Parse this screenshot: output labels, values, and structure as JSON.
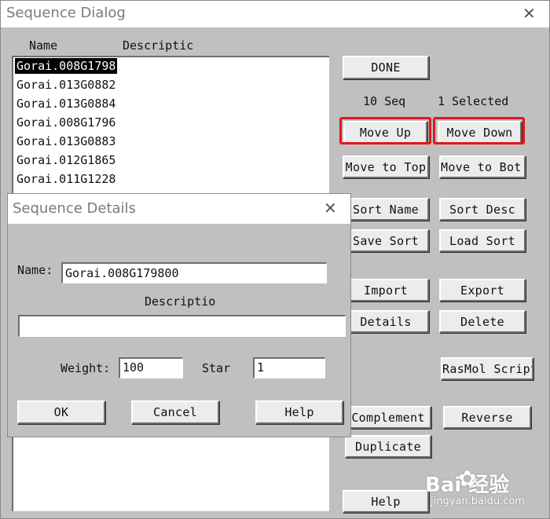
{
  "main_dialog": {
    "title": "Sequence Dialog",
    "close_glyph": "✕",
    "col_name": "Name",
    "col_desc": "Descriptic",
    "list": [
      "Gorai.008G1798",
      "Gorai.013G0882",
      "Gorai.013G0884",
      "Gorai.008G1796",
      "Gorai.013G0883",
      "Gorai.012G1865",
      "Gorai.011G1228"
    ],
    "seq_count": "10 Seq",
    "selected_count": "1 Selected",
    "buttons": {
      "done": "DONE",
      "move_up": "Move Up",
      "move_down": "Move Down",
      "move_top": "Move to Top",
      "move_bot": "Move to Bot.",
      "sort_name": "Sort Name",
      "sort_desc": "Sort Desc",
      "save_sort": "Save Sort",
      "load_sort": "Load Sort",
      "import": "Import",
      "export": "Export",
      "details": "Details",
      "delete": "Delete",
      "rasmol": "RasMol Script",
      "complement": "Complement",
      "reverse": "Reverse",
      "duplicate": "Duplicate",
      "help": "Help"
    },
    "highlight_color": "#e3161b"
  },
  "details_dialog": {
    "title": "Sequence Details",
    "close_glyph": "✕",
    "name_label": "Name:",
    "name_value": "Gorai.008G179800",
    "desc_label": "Descriptio",
    "desc_value": "",
    "weight_label": "Weight:",
    "weight_value": "100",
    "start_label": "Star",
    "start_value": "1",
    "ok": "OK",
    "cancel": "Cancel",
    "help": "Help"
  },
  "watermark": {
    "brand": "Bai  经验",
    "url": "jingyan.baidu.com"
  }
}
